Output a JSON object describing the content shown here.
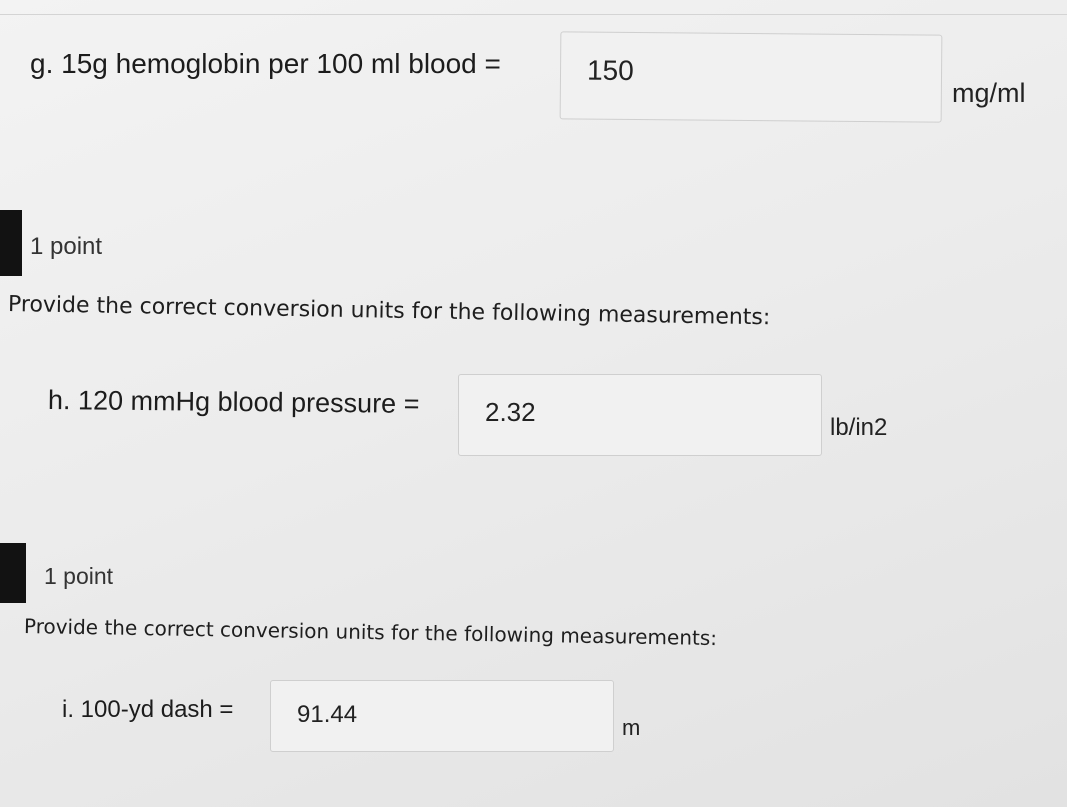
{
  "questions": {
    "g": {
      "label": "g. 15g hemoglobin per 100 ml blood =",
      "answer": "150",
      "unit": "mg/ml"
    },
    "h": {
      "points": "1 point",
      "prompt": "Provide the correct conversion units for the following measurements:",
      "label": "h. 120 mmHg blood pressure =",
      "answer": "2.32",
      "unit": "lb/in2"
    },
    "i": {
      "points": "1 point",
      "prompt": "Provide the correct conversion units for the following measurements:",
      "label": "i. 100-yd dash =",
      "answer": "91.44",
      "unit": "m"
    }
  }
}
